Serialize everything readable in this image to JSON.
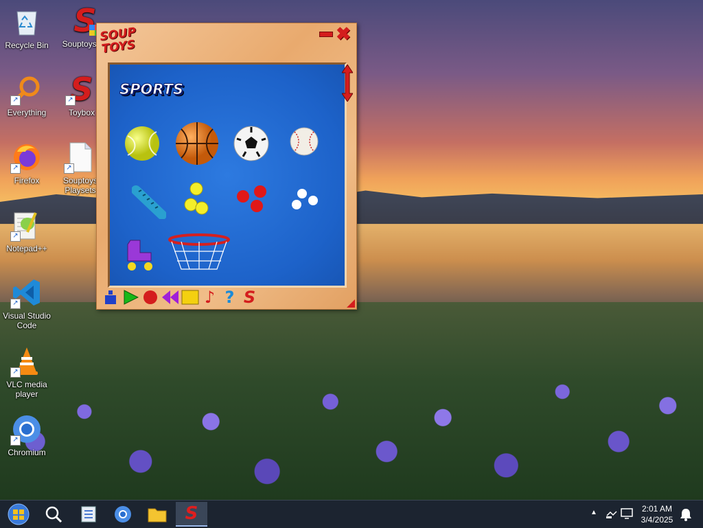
{
  "desktop": {
    "icons": [
      {
        "label": "Recycle Bin",
        "icon": "recycle-bin-icon"
      },
      {
        "label": "Souptoys I...",
        "icon": "souptoys-icon"
      },
      {
        "label": "Everything",
        "icon": "everything-search-icon"
      },
      {
        "label": "Toybox",
        "icon": "souptoys-icon"
      },
      {
        "label": "Firefox",
        "icon": "firefox-icon"
      },
      {
        "label": "Souptoys Playsets",
        "icon": "document-icon"
      },
      {
        "label": "Notepad++",
        "icon": "notepadpp-icon"
      },
      {
        "label": "Visual Studio Code",
        "icon": "vscode-icon"
      },
      {
        "label": "VLC media player",
        "icon": "vlc-icon"
      },
      {
        "label": "Chromium",
        "icon": "chromium-icon"
      }
    ]
  },
  "window": {
    "logo": "SOUP TOYS",
    "panel_title": "SPORTS",
    "toys": [
      "tennis ball",
      "basketball",
      "soccer ball",
      "baseball",
      "spring",
      "yellow balls",
      "red balls",
      "white balls",
      "roller skate",
      "basketball hoop"
    ],
    "toolbar": [
      "tool-icon",
      "play-icon",
      "record-icon",
      "rewind-icon",
      "stop-icon",
      "music-icon",
      "help-icon",
      "souptoys-icon"
    ]
  },
  "taskbar": {
    "apps": [
      "start-orb-icon",
      "search-icon",
      "file-explorer-icon",
      "chromium-icon",
      "folder-icon",
      "souptoys-icon"
    ],
    "time": "2:01 AM",
    "date": "3/4/2025"
  }
}
